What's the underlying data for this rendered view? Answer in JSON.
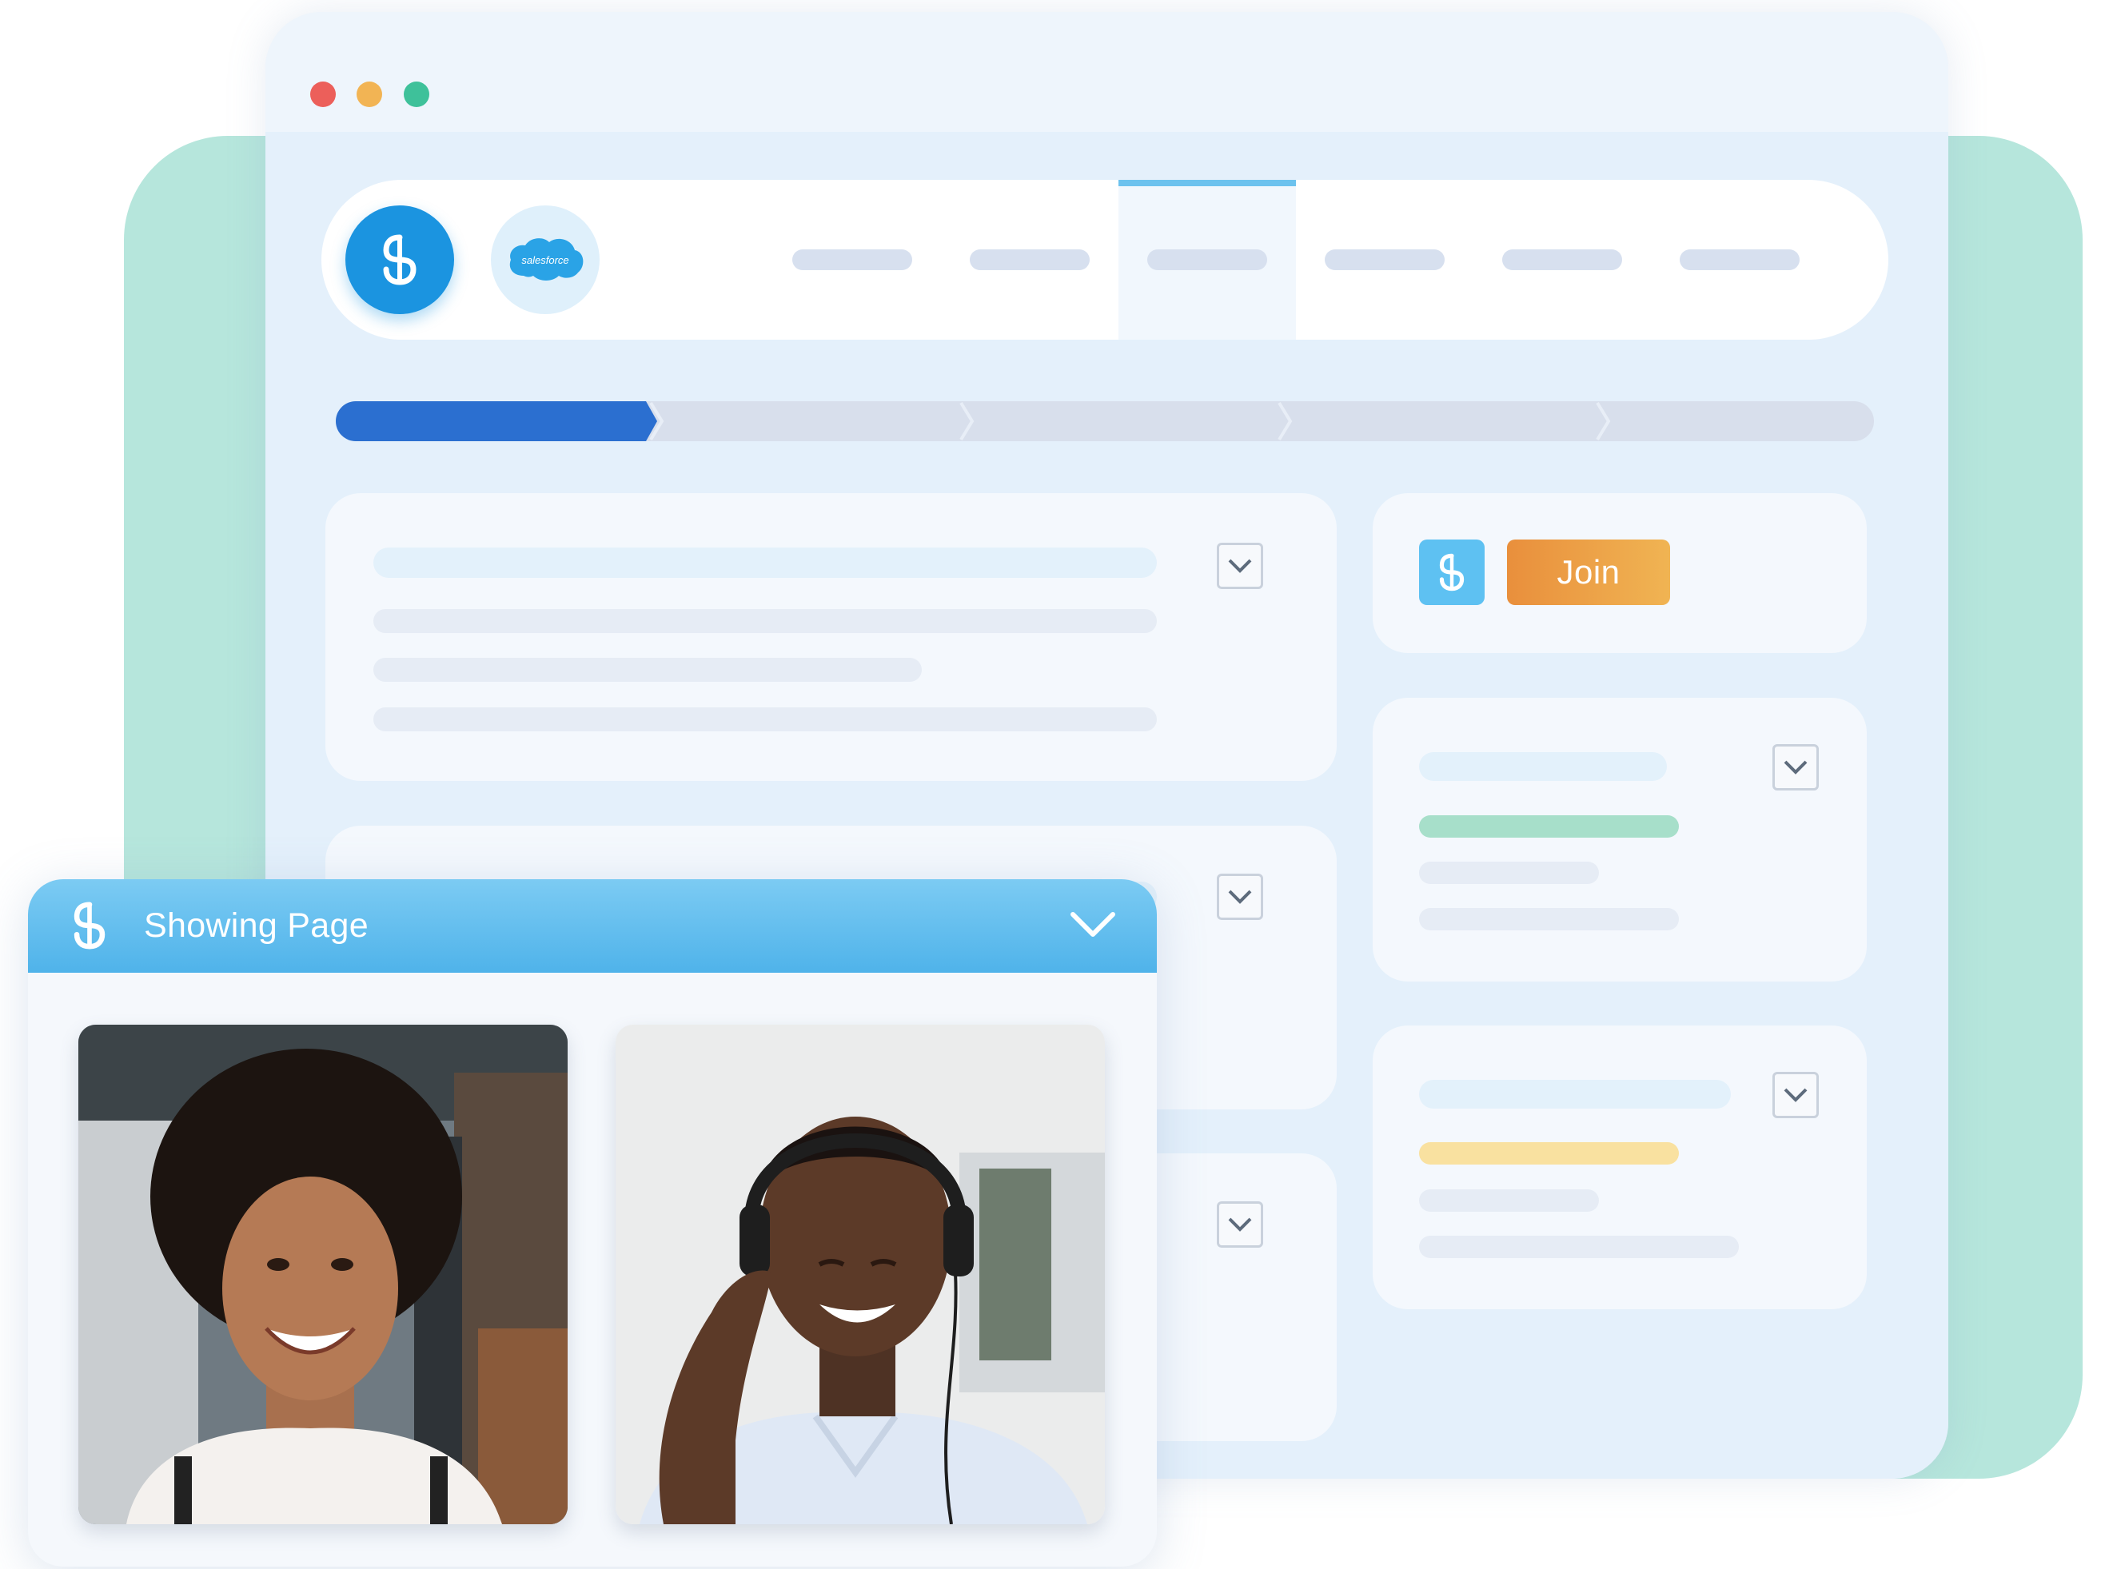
{
  "window": {
    "controls": [
      "close",
      "minimize",
      "maximize"
    ]
  },
  "navbar": {
    "brand_icon": "app-logo-icon",
    "integration_logo_text": "salesforce",
    "tabs": [
      {
        "id": "tab-1",
        "active": false
      },
      {
        "id": "tab-2",
        "active": false
      },
      {
        "id": "tab-3",
        "active": true
      },
      {
        "id": "tab-4",
        "active": false
      },
      {
        "id": "tab-5",
        "active": false
      },
      {
        "id": "tab-6",
        "active": false
      }
    ]
  },
  "stepper": {
    "total_steps": 5,
    "current_step": 1
  },
  "join_card": {
    "app_icon": "app-logo-icon",
    "join_label": "Join"
  },
  "call_panel": {
    "title": "Showing Page",
    "collapse_icon": "chevron-down-icon",
    "participants": [
      {
        "name": "participant-woman",
        "kind": "video"
      },
      {
        "name": "participant-man-headset",
        "kind": "video"
      }
    ]
  },
  "colors": {
    "accent_blue": "#1b94e0",
    "progress_blue": "#2b6fd0",
    "join_orange": "#e98f3c",
    "status_green": "#a7dfca",
    "status_yellow": "#f9e1a0",
    "backdrop_green": "#b6e6dc"
  }
}
